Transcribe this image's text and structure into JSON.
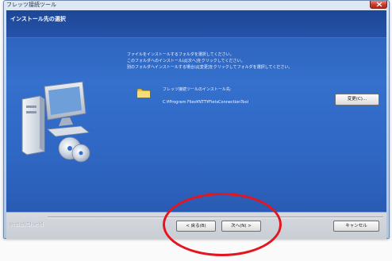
{
  "window": {
    "title": "フレッツ接続ツール"
  },
  "header": {
    "title": "インストール先の選択"
  },
  "main": {
    "instructions": [
      "ファイルをインストールするフォルダを選択してください。",
      "このフォルダへのインストールは[次へ]をクリックしてください。",
      "別のフォルダへインストールする場合は[変更]をクリックしてフォルダを選択してください。"
    ],
    "install_label": "フレッツ接続ツールのインストール先:",
    "install_path": "C:¥Program Files¥NTT¥FletsConnectionTool",
    "change_button": "変更(C)..."
  },
  "footer": {
    "brand": "InstallShield",
    "back_button": "< 戻る(B)",
    "next_button": "次へ(N) >",
    "cancel_button": "キャンセル"
  },
  "icons": {
    "close": "close-icon",
    "folder": "folder-icon",
    "computer": "computer-illustration-icon"
  },
  "colors": {
    "content_blue": "#3470cc",
    "header_blue": "#1d4697",
    "footer_gray": "#c9cdd4",
    "annotation_red": "#e3161f",
    "folder_yellow": "#f2d25a"
  }
}
